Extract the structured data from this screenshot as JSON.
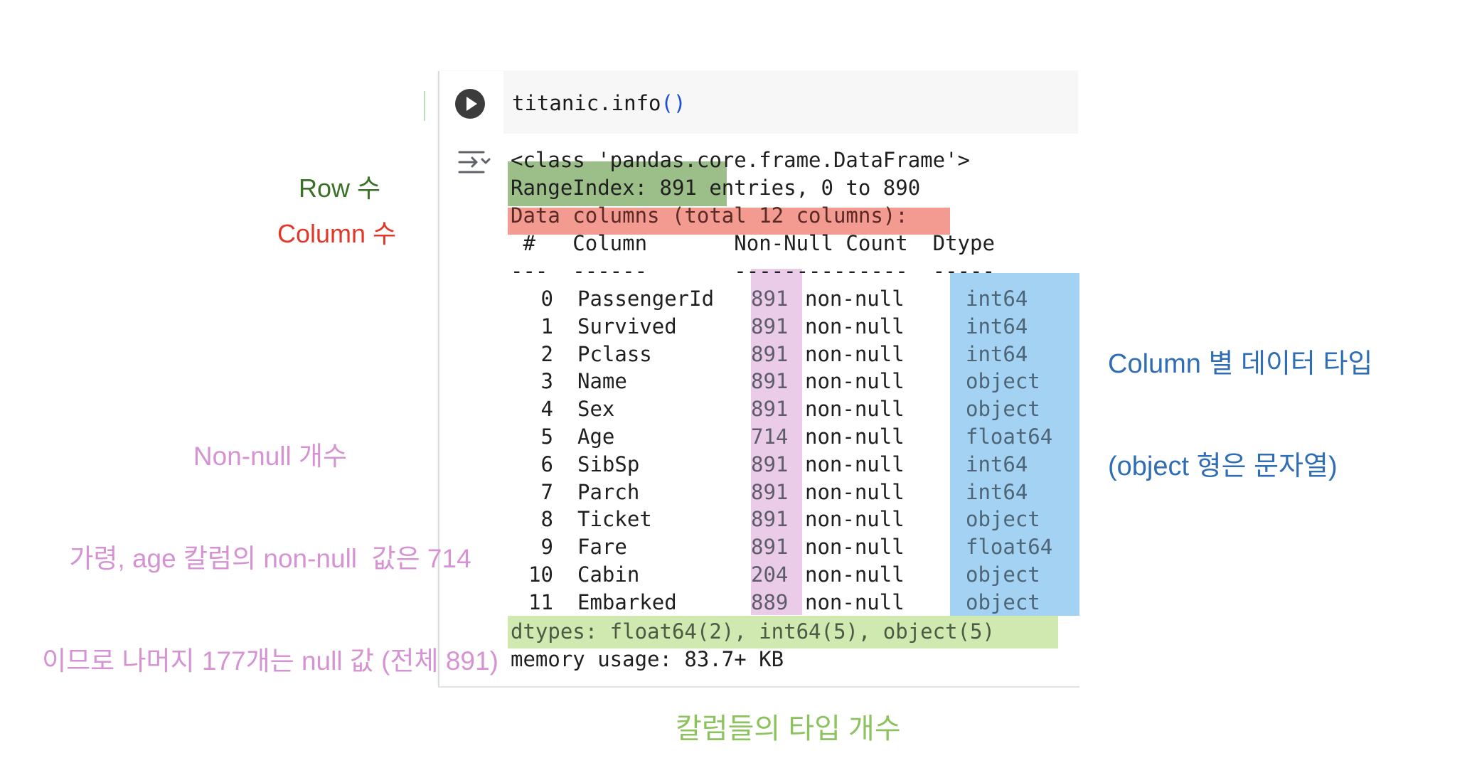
{
  "cell": {
    "code_prefix": "titanic.info",
    "code_parens": "()"
  },
  "output": {
    "class_line": "<class 'pandas.core.frame.DataFrame'>",
    "range_index": "RangeIndex: 891 entries, 0 to 890",
    "data_columns": "Data columns (total 12 columns):",
    "header": " #   Column       Non-Null Count  Dtype  ",
    "separator": "---  ------       --------------  -----  ",
    "rows": [
      {
        "idx": "0",
        "column": "PassengerId",
        "count": "891",
        "nonnull": "non-null",
        "dtype": "int64"
      },
      {
        "idx": "1",
        "column": "Survived",
        "count": "891",
        "nonnull": "non-null",
        "dtype": "int64"
      },
      {
        "idx": "2",
        "column": "Pclass",
        "count": "891",
        "nonnull": "non-null",
        "dtype": "int64"
      },
      {
        "idx": "3",
        "column": "Name",
        "count": "891",
        "nonnull": "non-null",
        "dtype": "object"
      },
      {
        "idx": "4",
        "column": "Sex",
        "count": "891",
        "nonnull": "non-null",
        "dtype": "object"
      },
      {
        "idx": "5",
        "column": "Age",
        "count": "714",
        "nonnull": "non-null",
        "dtype": "float64"
      },
      {
        "idx": "6",
        "column": "SibSp",
        "count": "891",
        "nonnull": "non-null",
        "dtype": "int64"
      },
      {
        "idx": "7",
        "column": "Parch",
        "count": "891",
        "nonnull": "non-null",
        "dtype": "int64"
      },
      {
        "idx": "8",
        "column": "Ticket",
        "count": "891",
        "nonnull": "non-null",
        "dtype": "object"
      },
      {
        "idx": "9",
        "column": "Fare",
        "count": "891",
        "nonnull": "non-null",
        "dtype": "float64"
      },
      {
        "idx": "10",
        "column": "Cabin",
        "count": "204",
        "nonnull": "non-null",
        "dtype": "object"
      },
      {
        "idx": "11",
        "column": "Embarked",
        "count": "889",
        "nonnull": "non-null",
        "dtype": "object"
      }
    ],
    "dtypes_line": "dtypes: float64(2), int64(5), object(5)",
    "memory_line": "memory usage: 83.7+ KB"
  },
  "annotations": {
    "row_count": "Row 수",
    "column_count": "Column 수",
    "nonnull": [
      "Non-null 개수",
      "가령, age 칼럼의 non-null  값은 714",
      "이므로 나머지 177개는 null 값 (전체 891)"
    ],
    "dtype": [
      "Column 별 데이터 타입",
      "(object 형은 문자열)"
    ],
    "dtypes_count": "칼럼들의 타입 개수"
  },
  "icons": {
    "run": "play-icon",
    "output": "output-collapse-icon"
  },
  "colors": {
    "row_highlight": "#9cbf8a",
    "column_highlight": "#f39a91",
    "nonnull_highlight": "#ebcce8",
    "dtype_highlight": "#a3d2f2",
    "dtypes_highlight": "#cfe9b1",
    "row_annotation": "#3b7027",
    "column_annotation": "#e0392a",
    "nonnull_annotation": "#d693d3",
    "dtype_annotation": "#2f6db5",
    "dtypes_annotation": "#8cc35f"
  }
}
